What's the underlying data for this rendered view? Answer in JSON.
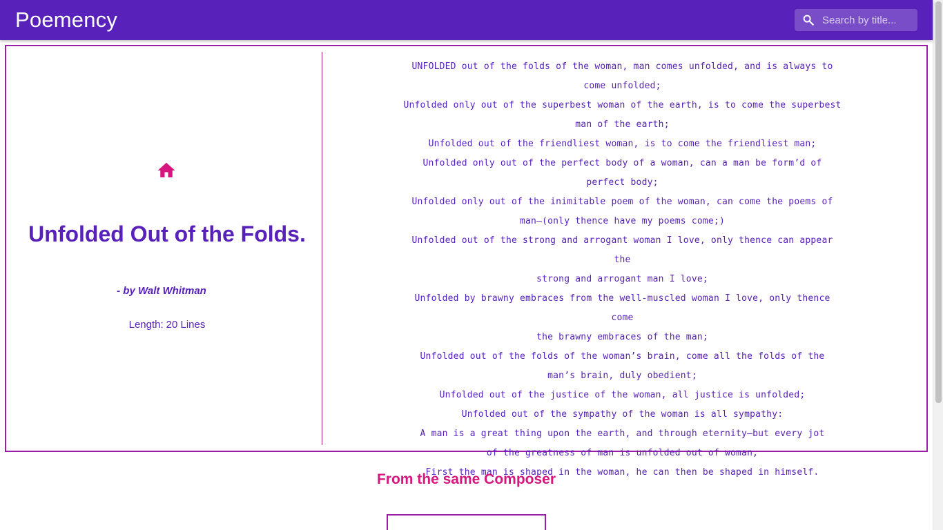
{
  "app": {
    "brand": "Poemency",
    "search_placeholder": "Search by title..."
  },
  "poem": {
    "title": "Unfolded Out of the Folds.",
    "author": "- by Walt Whitman",
    "length_label": "Length:",
    "length_value": "20 Lines",
    "lines": [
      "UNFOLDED out of the folds of the woman, man comes unfolded, and is always to",
      "come unfolded;",
      "Unfolded only out of the superbest woman of the earth, is to come the superbest",
      "man of the earth;",
      "Unfolded out of the friendliest woman, is to come the friendliest man;",
      "Unfolded only out of the perfect body of a woman, can a man be form’d of",
      "perfect body;",
      "Unfolded only out of the inimitable poem of the woman, can come the poems of",
      "man—(only thence have my poems come;)",
      "Unfolded out of the strong and arrogant woman I love, only thence can appear the",
      "strong and arrogant man I love;",
      "Unfolded by brawny embraces from the well-muscled woman I love, only thence come",
      "the brawny embraces of the man;",
      "Unfolded out of the folds of the woman’s brain, come all the folds of the",
      "man’s brain, duly obedient;",
      "Unfolded out of the justice of the woman, all justice is unfolded;",
      "Unfolded out of the sympathy of the woman is all sympathy:",
      "A man is a great thing upon the earth, and through eternity—but every jot",
      "of the greatness of man is unfolded out of woman,",
      "First the man is shaped in the woman, he can then be shaped in himself."
    ]
  },
  "same_composer": {
    "heading": "From the same Composer"
  },
  "icons": {
    "search": "search-icon",
    "home": "home-icon"
  },
  "colors": {
    "primary": "#5721ba",
    "accent": "#d6157f",
    "border": "#9c1ca8"
  }
}
